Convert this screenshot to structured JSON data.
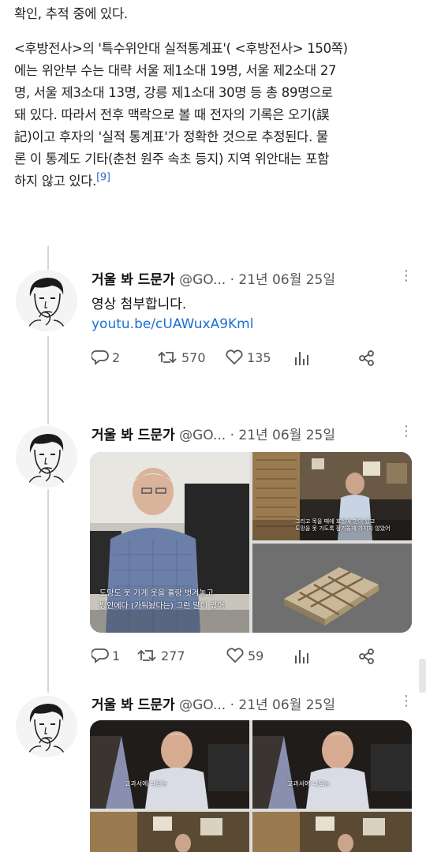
{
  "article": {
    "line0": "확인, 추적 중에 있다.",
    "lines": [
      "<후방전사>의 '특수위안대 실적통계표'( <후방전사> 150쪽)",
      "에는 위안부 수는 대략 서울 제1소대 19명, 서울 제2소대 27",
      "명, 서울 제3소대 13명, 강릉 제1소대 30명 등 총 89명으로",
      "돼 있다. 따라서 전후 맥락으로 볼 때 전자의 기록은 오기(誤",
      "記)이고 후자의 '실적 통계표'가 정확한 것으로 추정된다. 물",
      "론 이 통계도 기타(춘천 원주 속초 등지) 지역 위안대는 포함",
      "하지 않고 있다."
    ],
    "citation": "[9]"
  },
  "tweets": [
    {
      "name": "거울 봐 드문가",
      "handle": "@GO...",
      "date": "· 21년 06월 25일",
      "more": "⋮",
      "text": "영상 첨부합니다.",
      "link": "youtu.be/cUAWuxA9Kml",
      "replies": "2",
      "retweets": "570",
      "likes": "135"
    },
    {
      "name": "거울 봐 드문가",
      "handle": "@GO...",
      "date": "· 21년 06월 25일",
      "more": "⋮",
      "replies": "1",
      "retweets": "277",
      "likes": "59",
      "subtitles": {
        "main_line1": "도망도 못 가게 옷을 홀랑 벗겨놓고",
        "main_line2": "방안에다 (가둬놨다는) 그런 말이 있어",
        "tr_line1": "그리고 목을 때에 호실에 방이 있고",
        "tr_line2": "도망을 못 가도록 잠가놓게 가지지 않았어"
      }
    },
    {
      "name": "거울 봐 드문가",
      "handle": "@GO...",
      "date": "· 21년 06월 25일",
      "more": "⋮",
      "subtitles": {
        "a": "교과서에 나오는",
        "b": "교과서에 나오는"
      }
    }
  ],
  "icons": {
    "reply": "reply-icon",
    "retweet": "retweet-icon",
    "like": "like-icon",
    "stats": "stats-icon",
    "share": "share-icon"
  },
  "colors": {
    "link": "#1d6fd1",
    "thread_line": "#cfd9de",
    "citation": "#3366cc"
  }
}
